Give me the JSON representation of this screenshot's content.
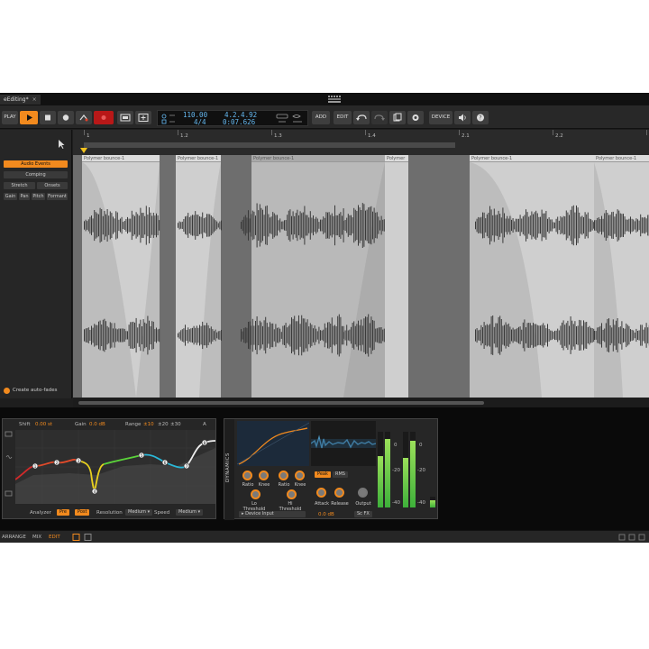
{
  "document_tab": {
    "title": "eEditing",
    "modified_marker": "*",
    "close": "×"
  },
  "toolbar": {
    "play_label": "PLAY",
    "tempo": "110.00",
    "time_signature": "4/4",
    "position": "4.2.4.92",
    "time": "0:07.626",
    "add_label": "ADD",
    "edit_label": "EDIT",
    "device_label": "DEVICE"
  },
  "left_panel": {
    "audio_events_label": "Audio Events",
    "comping_label": "Comping",
    "stretch_label": "Stretch",
    "onsets_label": "Onsets",
    "gain_label": "Gain",
    "pan_label": "Pan",
    "pitch_label": "Pitch",
    "formant_label": "Formant",
    "auto_fades_label": "Create auto-fades"
  },
  "ruler": {
    "marks": [
      "1",
      "1.2",
      "1.3",
      "1.4",
      "2.1",
      "2.2",
      "2.3"
    ]
  },
  "clips": [
    {
      "name": "Polymer bounce-1"
    },
    {
      "name": "Polymer bounce-1"
    },
    {
      "name": "Polymer bounce-1"
    },
    {
      "name": "Polymer"
    },
    {
      "name": "Polymer bounce-1"
    },
    {
      "name": "Polymer bounce-1"
    }
  ],
  "eq": {
    "shift_label": "Shift",
    "shift_value": "0.00 st",
    "gain_label": "Gain",
    "gain_value": "0.0 dB",
    "range_label": "Range",
    "range_options": [
      "±10",
      "±20",
      "±30"
    ],
    "range_selected": 0,
    "a_label": "A",
    "analyzer_label": "Analyzer",
    "pre_label": "Pre",
    "post_label": "Post",
    "resolution_label": "Resolution",
    "resolution_value": "Medium",
    "speed_label": "Speed",
    "speed_value": "Medium",
    "freq_labels": [
      "20",
      "50",
      "100",
      "200",
      "500",
      "1k",
      "2k",
      "5k",
      "10k"
    ],
    "db_labels": [
      "+6",
      "0",
      "-6",
      "-20",
      "-40",
      "-60"
    ],
    "bands": [
      "1",
      "2",
      "3",
      "4",
      "5",
      "6",
      "7",
      "8"
    ],
    "accent": "#f28a1e"
  },
  "dynamics": {
    "title": "DYNAMICS",
    "peak_label": "Peak",
    "rms_label": "RMS",
    "knobs": [
      "Ratio",
      "Knee",
      "Ratio",
      "Knee",
      "Attack",
      "Release",
      "Output"
    ],
    "lo_threshold_label": "Lo Threshold",
    "hi_threshold_label": "Hi Threshold",
    "input_label": "Device Input",
    "input_value": "0.0 dB",
    "sc_label": "Sc FX",
    "meter_labels": [
      "0",
      "-20",
      "-40"
    ],
    "meter_levels": [
      0.68,
      0.9,
      0.66,
      0.88
    ]
  },
  "statusbar": {
    "arrange_label": "ARRANGE",
    "mix_label": "MIX",
    "edit_label": "EDIT"
  }
}
